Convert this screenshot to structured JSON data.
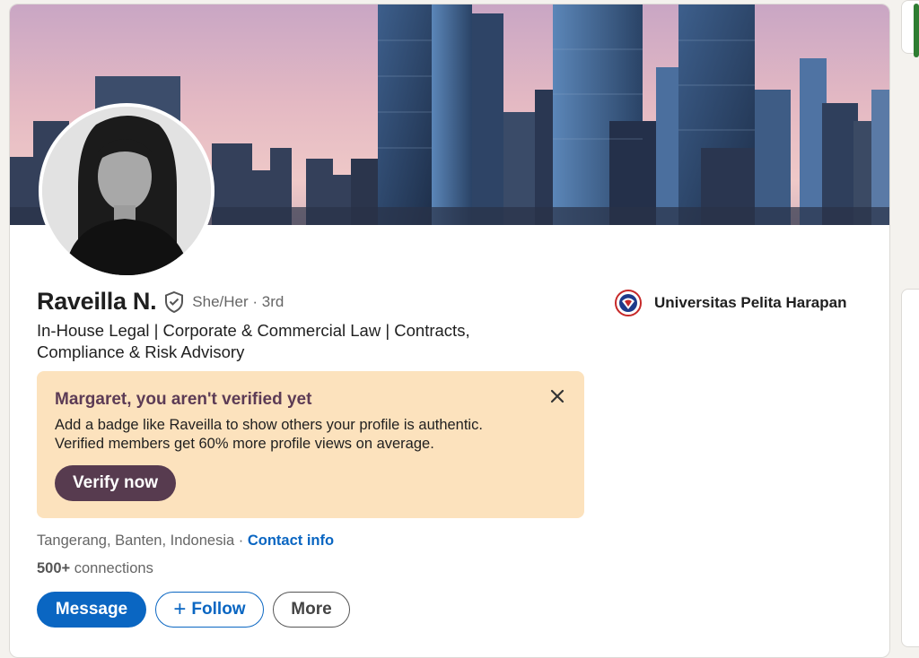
{
  "profile": {
    "name": "Raveilla N.",
    "pronouns": "She/Her",
    "degree_sep": " · ",
    "degree": "3rd",
    "headline": "In-House Legal | Corporate & Commercial Law | Contracts, Compliance & Risk Advisory",
    "education": "Universitas Pelita Harapan",
    "location": "Tangerang, Banten, Indonesia",
    "location_sep": " · ",
    "contact_info": "Contact info",
    "connections_count": "500+",
    "connections_label": " connections"
  },
  "verify": {
    "title": "Margaret, you aren't verified yet",
    "line1": "Add a badge like Raveilla to show others your profile is authentic.",
    "line2": "Verified members get 60% more profile views on average.",
    "button": "Verify now"
  },
  "actions": {
    "message": "Message",
    "follow_plus": "+",
    "follow": "Follow",
    "more": "More"
  },
  "colors": {
    "primary": "#0a66c2",
    "verify_bg": "#fce2bd",
    "verify_accent": "#573b4f"
  },
  "icons": [
    "verified-shield-icon",
    "close-icon",
    "university-logo",
    "plus-icon"
  ]
}
